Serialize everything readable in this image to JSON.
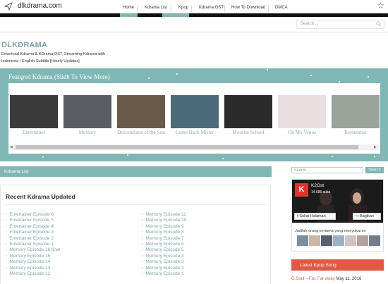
{
  "browser": {
    "url": "dlkdrama.com"
  },
  "menu": {
    "items": [
      "Home",
      "Kdrama List",
      "Kpop",
      "Kdrama OST",
      "How To Download",
      "DMCA"
    ],
    "search_placeholder": "Search ..."
  },
  "site": {
    "title": "DLKDRAMA",
    "tagline": "Download Kdrama & KDrama OST, Streaming Kdrama with Indonesia / English Subtitle [Hourly Updates]"
  },
  "featured": {
    "title": "Featured Kdrama (Slide To View More)",
    "items": [
      {
        "caption": "Entertainer",
        "color": "#3a3a3a"
      },
      {
        "caption": "Memory",
        "color": "#5b5d63"
      },
      {
        "caption": "Descendants of the Sun",
        "color": "#6b5a4a"
      },
      {
        "caption": "Come Back Mister",
        "color": "#4d6a7a"
      },
      {
        "caption": "Moorim School",
        "color": "#2b2b2b"
      },
      {
        "caption": "Oh My Venus",
        "color": "#e9dfe0"
      },
      {
        "caption": "Remember",
        "color": "#9aa49a"
      }
    ]
  },
  "kdrama_list": {
    "label": "Kdrama List"
  },
  "recent": {
    "title": "Recent Kdrama Updated",
    "left": [
      "Entertainer Episode 6",
      "Entertainer Episode 5",
      "Entertainer Episode 4",
      "Entertainer Episode 3",
      "Entertainer Episode 2",
      "Entertainer Episode 1",
      "Memory Episode 16 final",
      "Memory Episode 15",
      "Memory Episode 14",
      "Memory Episode 13",
      "Memory Episode 12"
    ],
    "right": [
      "Memory Episode 11",
      "Memory Episode 10",
      "Memory Episode 9",
      "Memory Episode 8",
      "Memory Episode 7",
      "Memory Episode 6",
      "Memory Episode 5",
      "Memory Episode 4",
      "Memory Episode 3",
      "Memory Episode 2",
      "Memory Episode 1"
    ]
  },
  "sidebar": {
    "search_placeholder": "Search ...",
    "search_button": "Search",
    "fb": {
      "name": "K2Ost",
      "likes": "14.685 suka",
      "like_button": "Sukai Halaman",
      "share_button": "Bagikan",
      "friends_text": "Jadilah orang pertama yang menyukai ini"
    },
    "latest_title": "Latest Kpop Song",
    "song_title": "G.Soul – Far, Far away",
    "song_date": " May 11, 2016"
  },
  "colors": {
    "accent": "#7fb7b4",
    "link": "#7fa7a6",
    "latest": "#e05a43",
    "k2": "#e4322b"
  }
}
